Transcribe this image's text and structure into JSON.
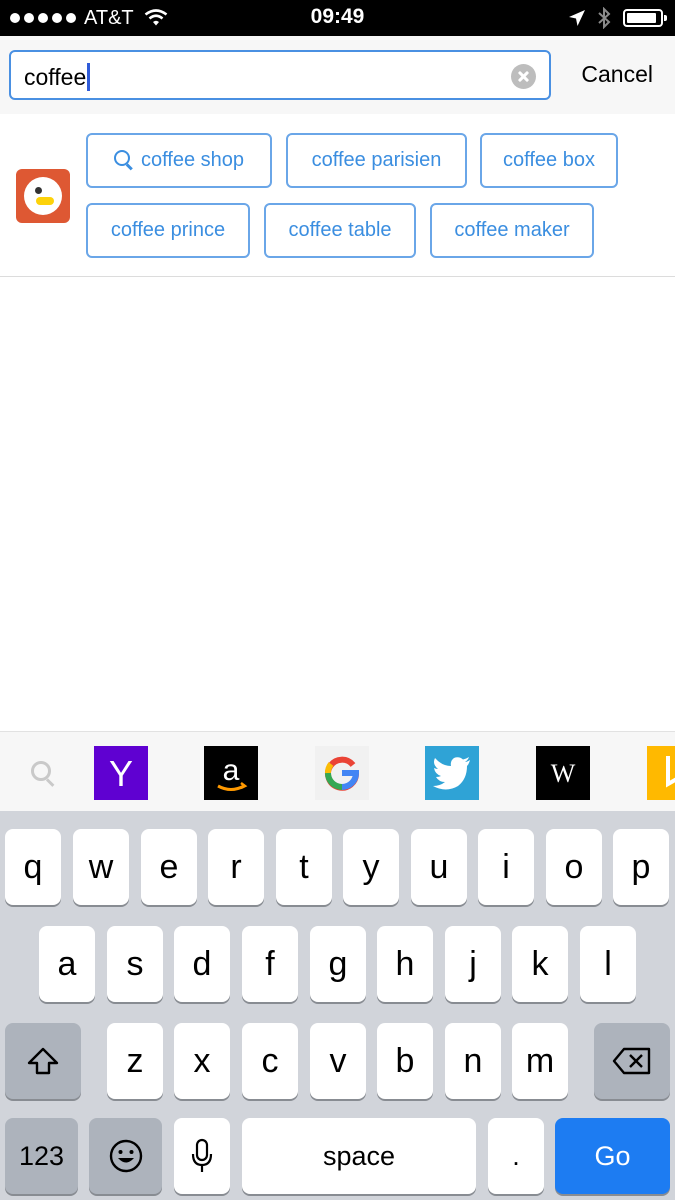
{
  "status_bar": {
    "carrier": "AT&T",
    "time": "09:49",
    "signal_bars": 5,
    "battery_level": 0.9
  },
  "search": {
    "query": "coffee",
    "cancel_label": "Cancel"
  },
  "suggestions": {
    "engine_icon": "duckduckgo-icon",
    "items": [
      "coffee shop",
      "coffee parisien",
      "coffee box",
      "coffee prince",
      "coffee table",
      "coffee maker"
    ]
  },
  "shortcuts": {
    "items": [
      {
        "name": "yahoo",
        "label": "Y",
        "color": "#5f01d1"
      },
      {
        "name": "amazon",
        "label": "a",
        "color": "#000000"
      },
      {
        "name": "google",
        "label": "G",
        "color": "#f1f1f1"
      },
      {
        "name": "twitter",
        "label": "",
        "color": "#2fa3d6"
      },
      {
        "name": "wikipedia",
        "label": "W",
        "color": "#000000"
      },
      {
        "name": "bing",
        "label": "b",
        "color": "#ffb900"
      }
    ]
  },
  "keyboard": {
    "row1": [
      "q",
      "w",
      "e",
      "r",
      "t",
      "y",
      "u",
      "i",
      "o",
      "p"
    ],
    "row2": [
      "a",
      "s",
      "d",
      "f",
      "g",
      "h",
      "j",
      "k",
      "l"
    ],
    "row3": [
      "z",
      "x",
      "c",
      "v",
      "b",
      "n",
      "m"
    ],
    "numbers_label": "123",
    "space_label": "space",
    "period_label": ".",
    "go_label": "Go"
  },
  "colors": {
    "accent": "#4a90e2",
    "go_key": "#1d7cf2",
    "keyboard_bg": "#d1d4da"
  }
}
